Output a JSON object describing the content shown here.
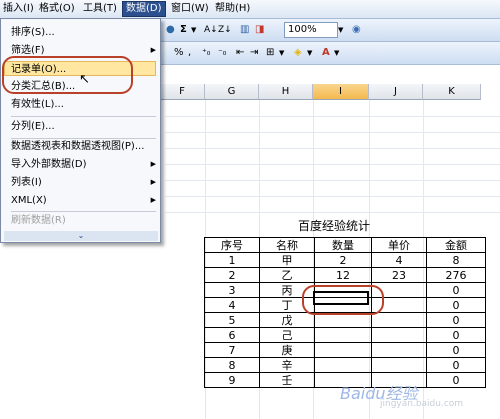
{
  "menubar": [
    "插入(I)",
    "格式(O)",
    "工具(T)",
    "数据(D)",
    "窗口(W)",
    "帮助(H)"
  ],
  "toolbar": {
    "sum_symbol": "Σ",
    "zoom": "100%",
    "percent": "%",
    "comma": ","
  },
  "columns": [
    "F",
    "G",
    "H",
    "I",
    "J",
    "K"
  ],
  "selected_column": "I",
  "data_menu": {
    "items": [
      {
        "label": "排序(S)...",
        "submenu": false,
        "disabled": false
      },
      {
        "label": "筛选(F)",
        "submenu": true,
        "disabled": false
      },
      {
        "label": "记录单(O)...",
        "submenu": false,
        "disabled": false,
        "highlighted": true
      },
      {
        "label": "分类汇总(B)...",
        "submenu": false,
        "disabled": false
      },
      {
        "label": "有效性(L)...",
        "submenu": false,
        "disabled": false
      },
      {
        "label": "分列(E)...",
        "submenu": false,
        "disabled": false
      },
      {
        "label": "数据透视表和数据透视图(P)...",
        "submenu": false,
        "disabled": false
      },
      {
        "label": "导入外部数据(D)",
        "submenu": true,
        "disabled": false
      },
      {
        "label": "列表(I)",
        "submenu": true,
        "disabled": false
      },
      {
        "label": "XML(X)",
        "submenu": true,
        "disabled": false
      },
      {
        "label": "刷新数据(R)",
        "submenu": false,
        "disabled": true
      }
    ],
    "expand_symbol": "⌄"
  },
  "table": {
    "title": "百度经验统计",
    "headers": [
      "序号",
      "名称",
      "数量",
      "单价",
      "金额"
    ],
    "rows": [
      [
        "1",
        "甲",
        "2",
        "4",
        "8"
      ],
      [
        "2",
        "乙",
        "12",
        "23",
        "276"
      ],
      [
        "3",
        "丙",
        "",
        "",
        "0"
      ],
      [
        "4",
        "丁",
        "",
        "",
        "0"
      ],
      [
        "5",
        "戊",
        "",
        "",
        "0"
      ],
      [
        "6",
        "己",
        "",
        "",
        "0"
      ],
      [
        "7",
        "庚",
        "",
        "",
        "0"
      ],
      [
        "8",
        "辛",
        "",
        "",
        "0"
      ],
      [
        "9",
        "壬",
        "",
        "",
        "0"
      ]
    ]
  },
  "watermark": {
    "main": "Baidu经验",
    "url": "jingyan.baidu.com"
  }
}
